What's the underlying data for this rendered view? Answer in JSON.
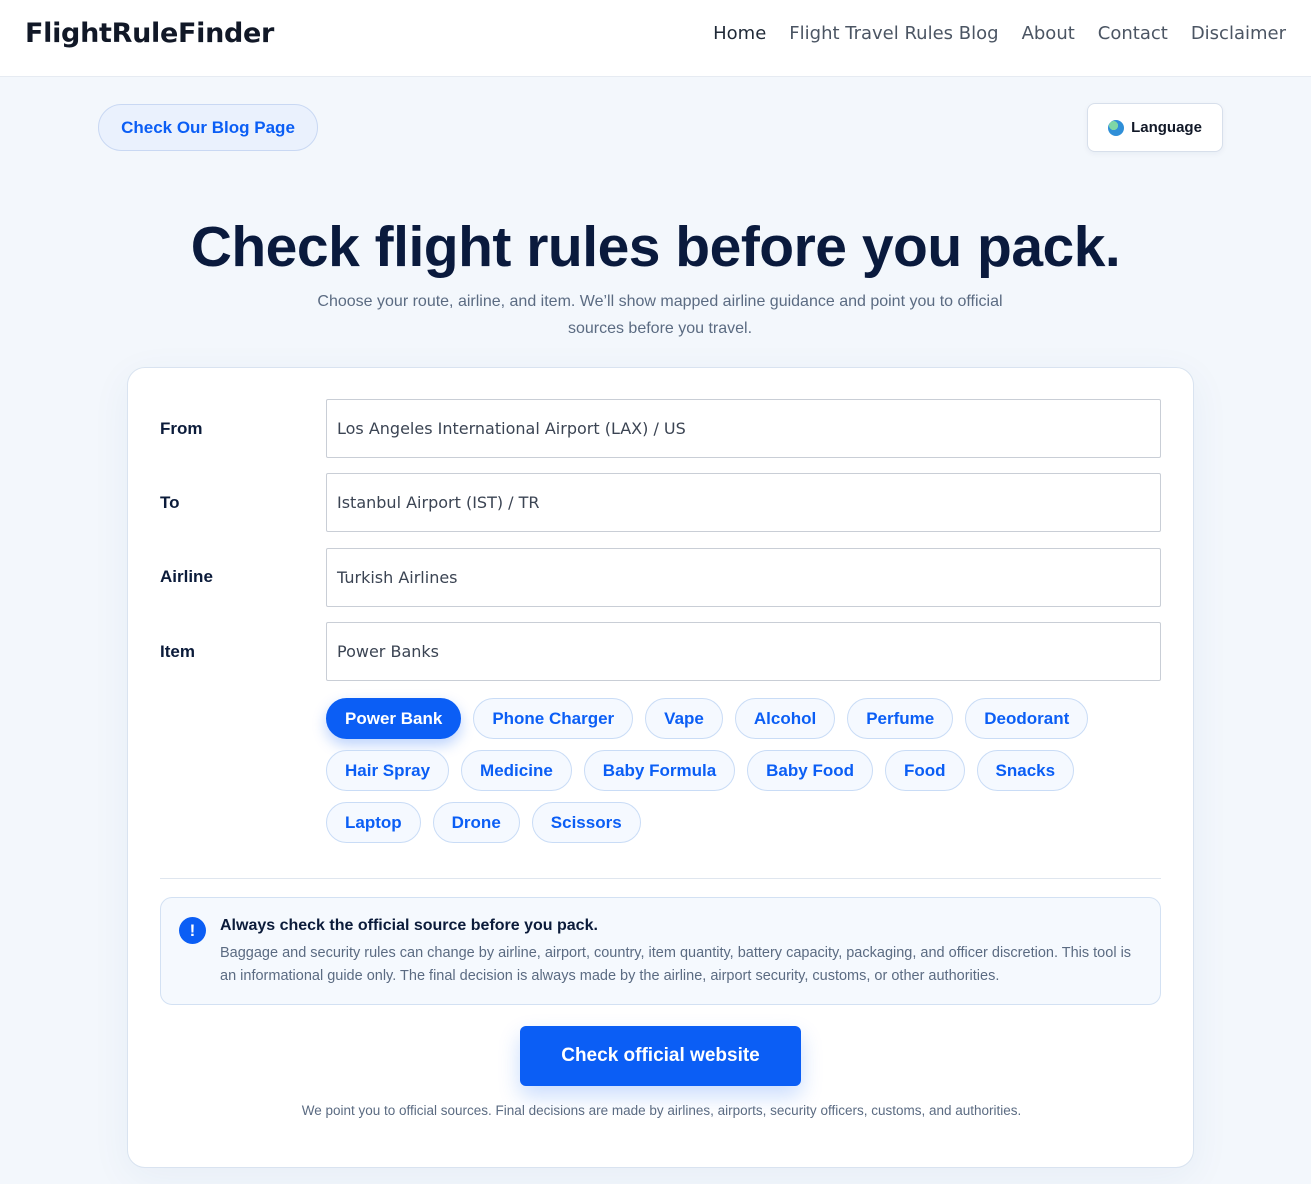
{
  "header": {
    "brand": "FlightRuleFinder",
    "nav": [
      "Home",
      "Flight Travel Rules Blog",
      "About",
      "Contact",
      "Disclaimer"
    ]
  },
  "actions": {
    "blog_label": "Check Our Blog Page",
    "language_label": "Language"
  },
  "hero": {
    "title": "Check flight rules before you pack.",
    "subtitle": "Choose your route, airline, and item. We’ll show mapped airline guidance and point you to official sources before you travel."
  },
  "form": {
    "from_label": "From",
    "from_value": "Los Angeles International Airport (LAX) / US",
    "to_label": "To",
    "to_value": "Istanbul Airport (IST) / TR",
    "airline_label": "Airline",
    "airline_value": "Turkish Airlines",
    "item_label": "Item",
    "item_value": "Power Banks"
  },
  "chips": [
    [
      "Power Bank",
      "Phone Charger",
      "Vape",
      "Alcohol",
      "Perfume",
      "Deodorant"
    ],
    [
      "Hair Spray",
      "Medicine",
      "Baby Formula",
      "Baby Food",
      "Food",
      "Snacks"
    ],
    [
      "Laptop",
      "Drone",
      "Scissors"
    ]
  ],
  "selected_chip": "Power Bank",
  "notice": {
    "icon": "!",
    "title": "Always check the official source before you pack.",
    "body": "Baggage and security rules can change by airline, airport, country, item quantity, battery capacity, packaging, and officer discretion. This tool is an informational guide only. The final decision is always made by the airline, airport security, customs, or other authorities."
  },
  "cta_label": "Check official website",
  "footnote": "We point you to official sources. Final decisions are made by airlines, airports, security officers, customs, and authorities.",
  "colors": {
    "accent": "#0b5ef5",
    "background": "#f3f7fc",
    "heading": "#0a1a3d"
  }
}
